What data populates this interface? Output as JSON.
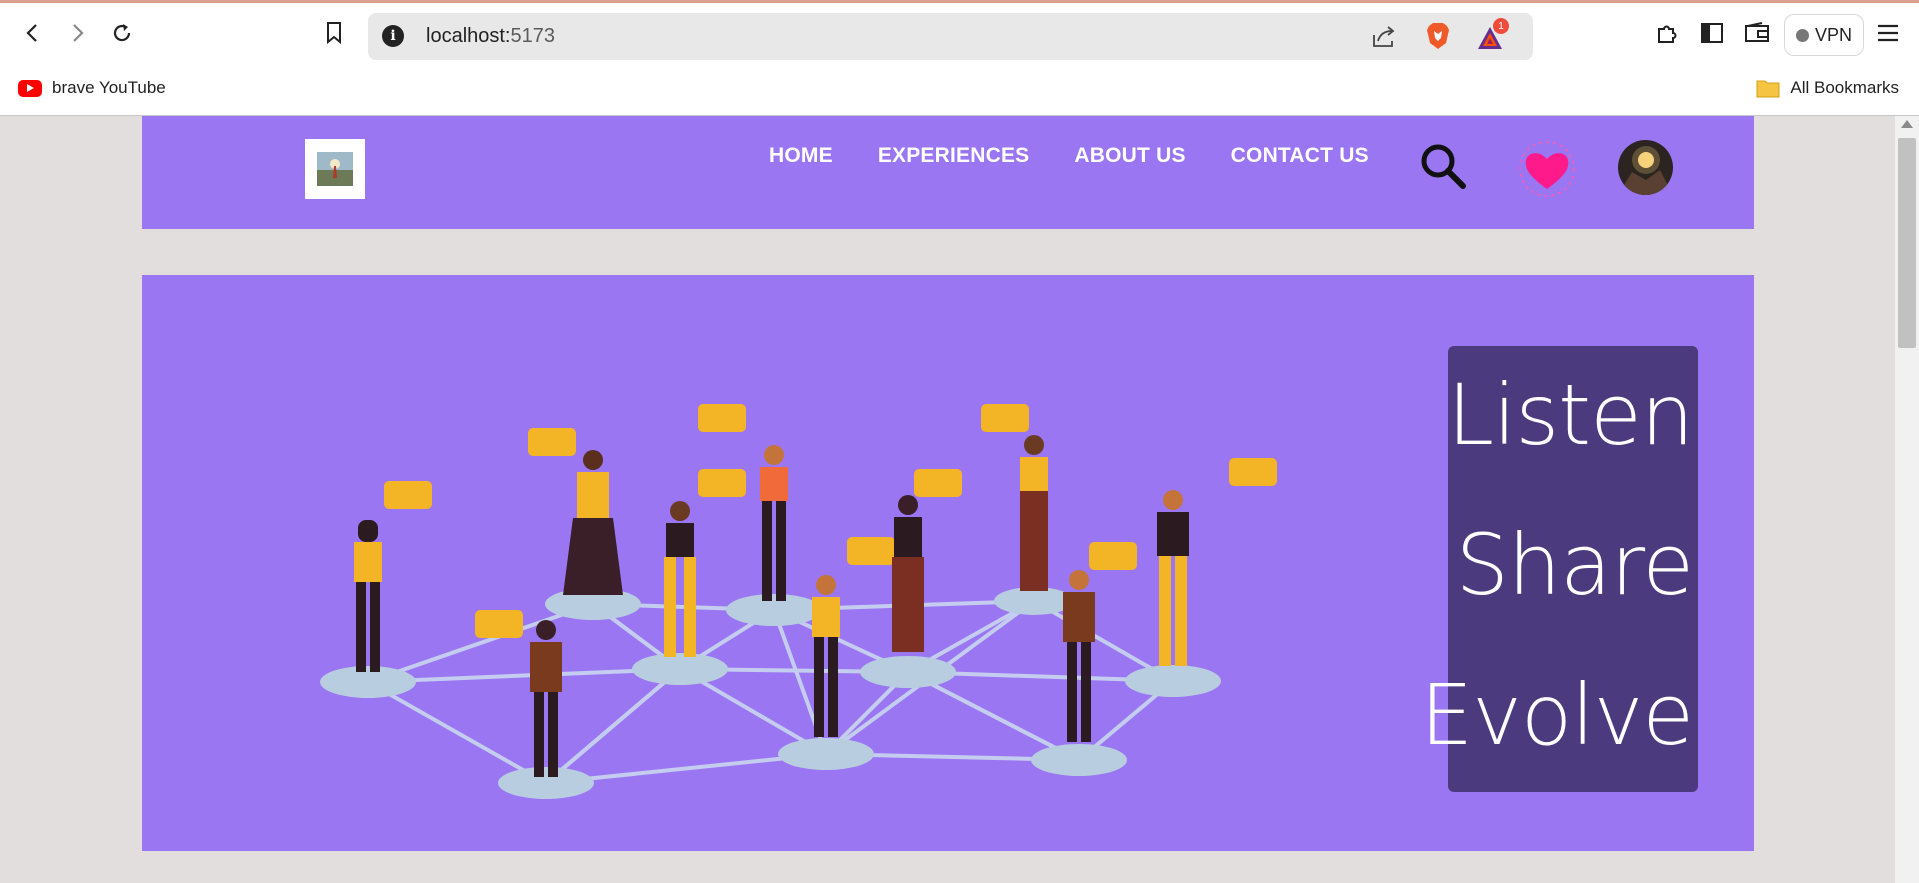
{
  "browser": {
    "url_host": "localhost:",
    "url_port": "5173",
    "notification_badge": "1",
    "vpn_label": "VPN"
  },
  "bookmarks": {
    "items": [
      {
        "label": "brave YouTube",
        "icon": "youtube-icon"
      }
    ],
    "all_bookmarks_label": "All Bookmarks"
  },
  "site": {
    "nav": {
      "links": [
        "HOME",
        "EXPERIENCES",
        "ABOUT US",
        "CONTACT US"
      ]
    },
    "hero": {
      "tagline": [
        "Listen",
        "Share",
        "Evolve"
      ]
    },
    "colors": {
      "nav_bg": "#9b76f2",
      "hero_bg": "#9b76f2",
      "tagline_bg": "#4b3a7d",
      "page_bg": "#e1dedd",
      "heart": "#ff1a8c"
    }
  }
}
